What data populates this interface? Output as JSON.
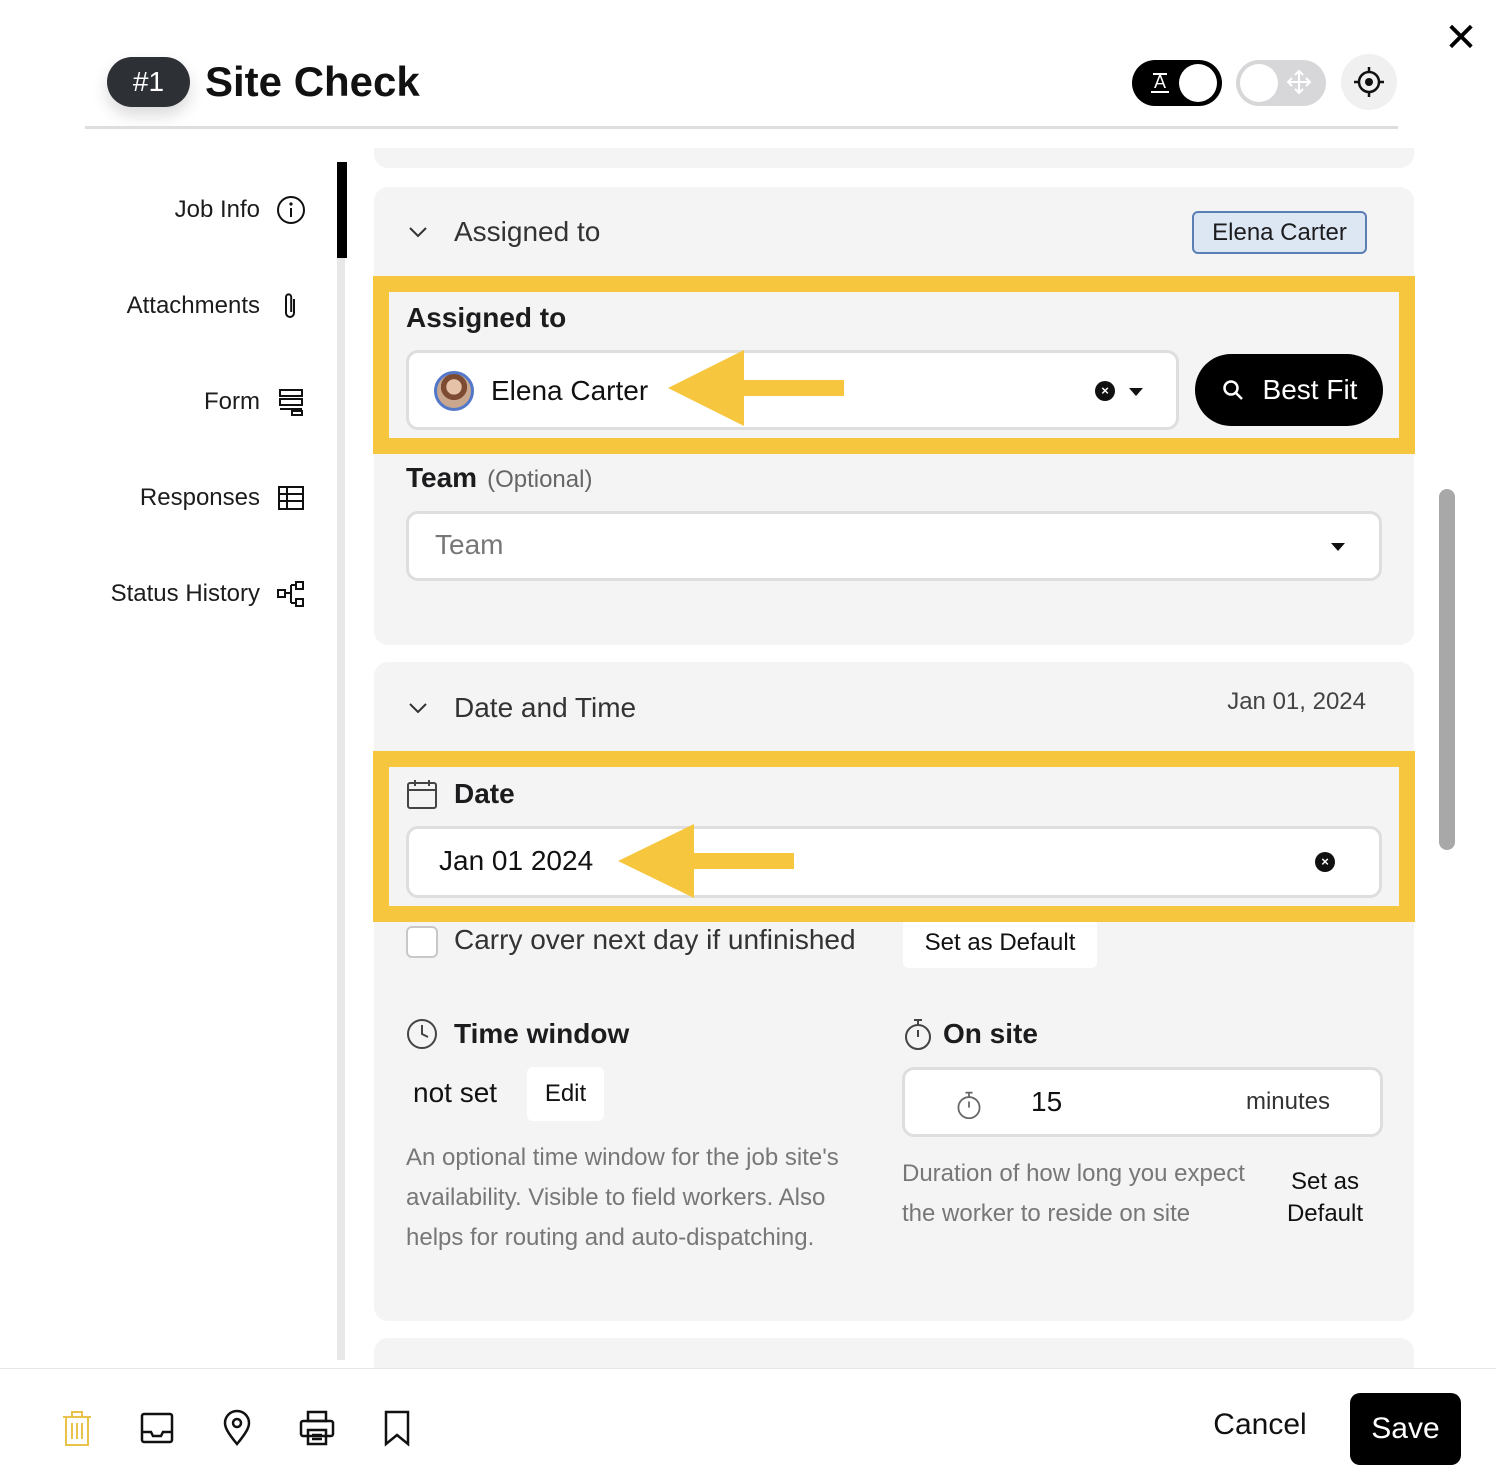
{
  "header": {
    "job_number": "#1",
    "title": "Site Check",
    "close_label": "✕",
    "text_toggle_glyph": "A"
  },
  "sidebar": {
    "items": [
      {
        "label": "Job Info",
        "icon": "info-icon",
        "active": true
      },
      {
        "label": "Attachments",
        "icon": "paperclip-icon"
      },
      {
        "label": "Form",
        "icon": "form-icon"
      },
      {
        "label": "Responses",
        "icon": "table-icon"
      },
      {
        "label": "Status History",
        "icon": "flow-icon"
      }
    ]
  },
  "assigned_section": {
    "heading": "Assigned to",
    "badge": "Elena Carter",
    "field_label": "Assigned to",
    "assignee_value": "Elena Carter",
    "best_fit_label": "Best Fit",
    "team_label": "Team",
    "team_optional": "(Optional)",
    "team_placeholder": "Team"
  },
  "date_section": {
    "heading": "Date and Time",
    "summary": "Jan 01, 2024",
    "date_label": "Date",
    "date_value": "Jan 01 2024",
    "carry_over_label": "Carry over next day if unfinished",
    "carry_over_checked": false,
    "set_default_label": "Set as Default",
    "time_window_label": "Time window",
    "time_window_value": "not set",
    "edit_label": "Edit",
    "time_window_help": "An optional time window for the job site's availability. Visible to field workers. Also helps for routing and auto-dispatching.",
    "on_site_label": "On site",
    "on_site_value": "15",
    "on_site_unit": "minutes",
    "on_site_help": "Duration of how long you expect the worker to reside on site",
    "on_site_set_default_label": "Set as Default"
  },
  "footer": {
    "icons": [
      "trash-icon",
      "inbox-icon",
      "location-pin-icon",
      "print-icon",
      "bookmark-icon"
    ],
    "cancel_label": "Cancel",
    "save_label": "Save"
  },
  "colors": {
    "highlight": "#f5c63e",
    "primary": "#000000",
    "card_bg": "#f4f4f4",
    "badge_bg": "#dde7f4",
    "badge_border": "#5b7fb5",
    "trash": "#e8c24a"
  }
}
